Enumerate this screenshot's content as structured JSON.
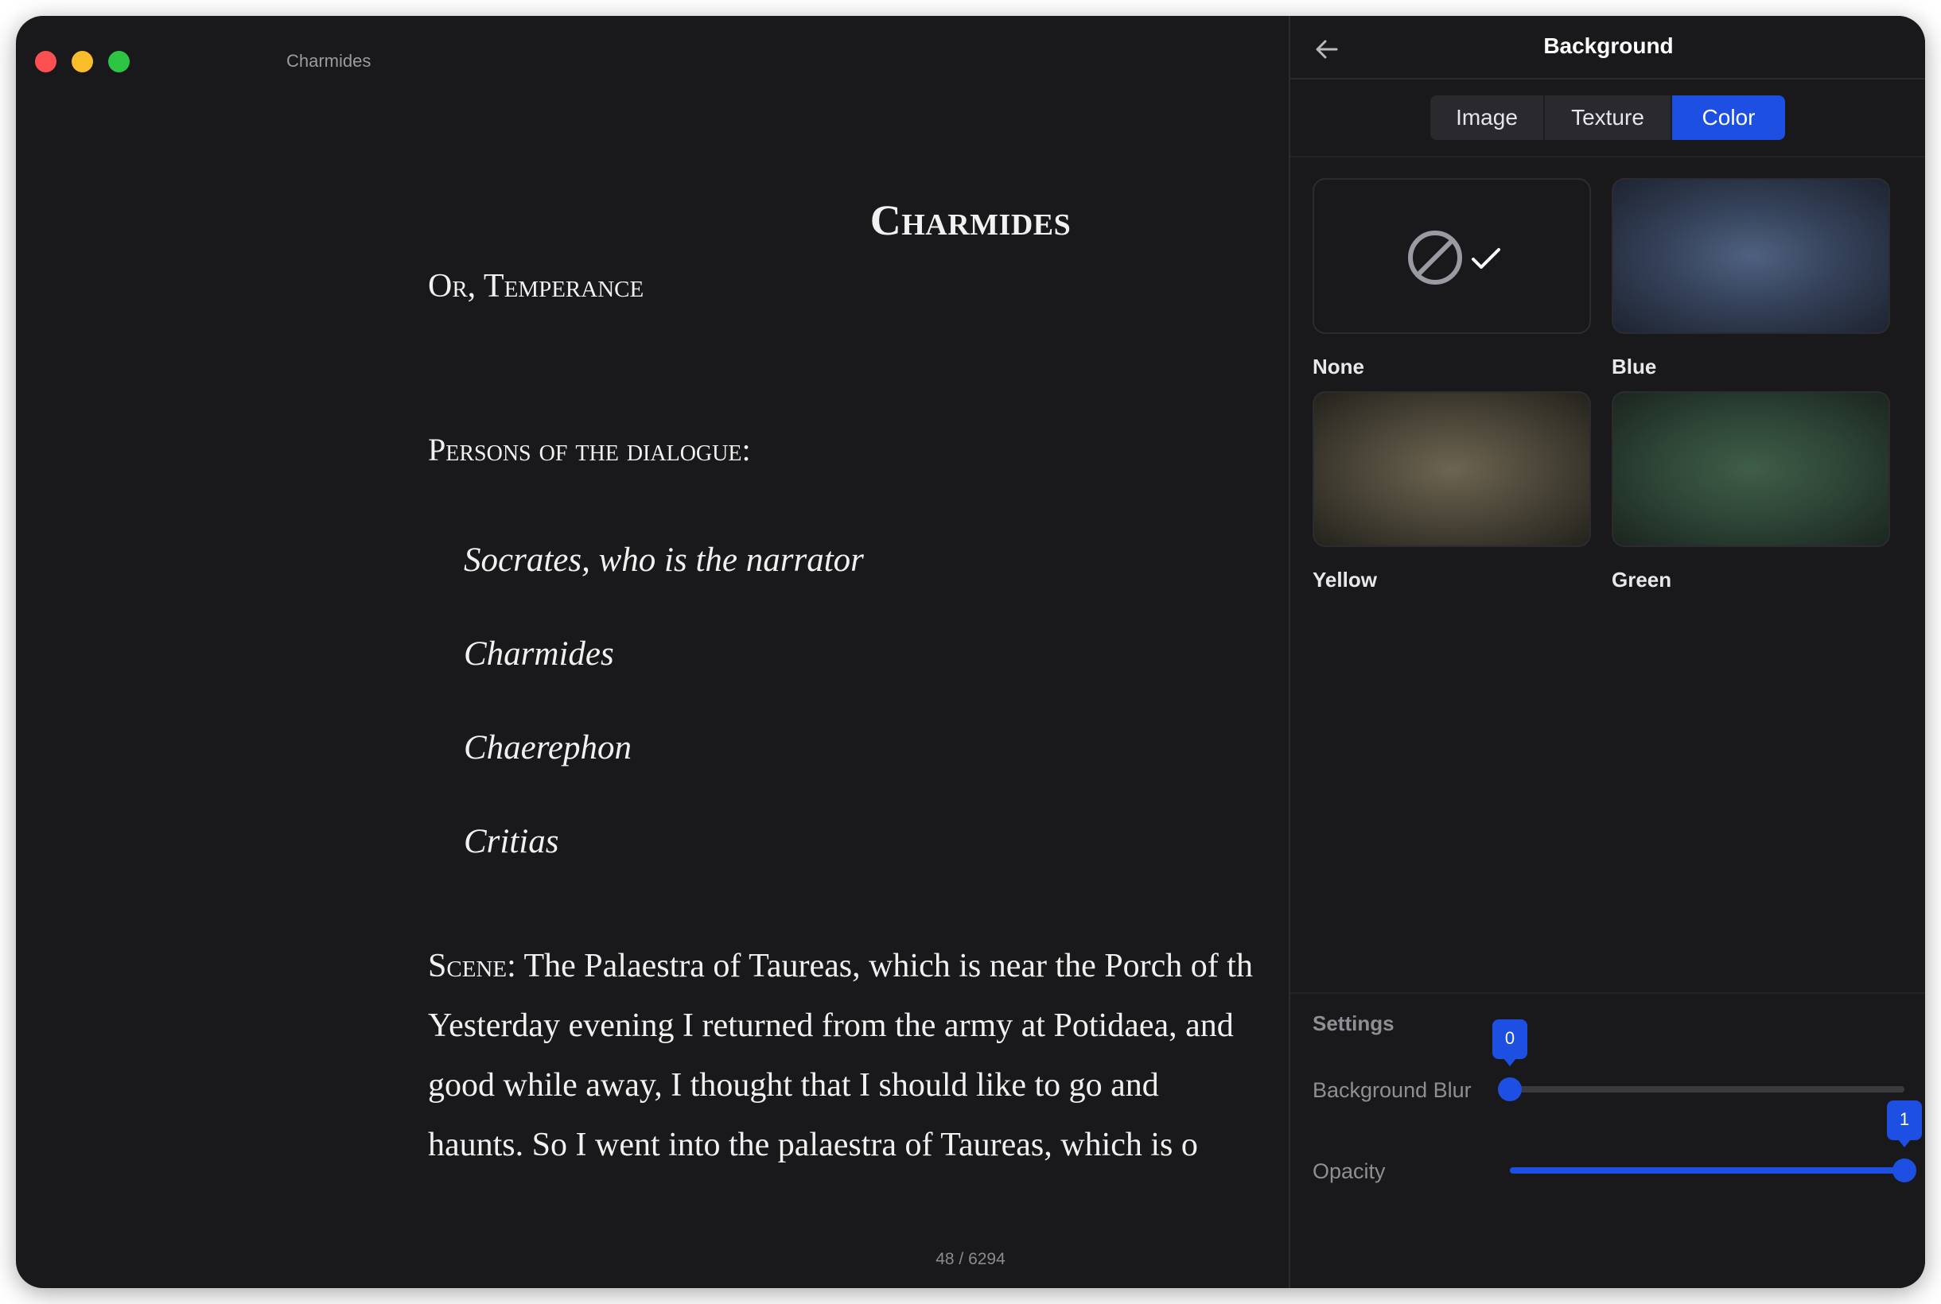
{
  "window": {
    "title": "Charmides"
  },
  "book": {
    "title": "Charmides",
    "subtitle": "Or, Temperance",
    "persons_heading": "Persons of the dialogue:",
    "persons": [
      "Socrates, who is the narrator",
      "Charmides",
      "Chaerephon",
      "Critias"
    ],
    "scene_label": "Scene:",
    "scene_lines": [
      " The Palaestra of Taureas, which is near the Porch of th",
      "Yesterday evening I returned from the army at Potidaea, and",
      "good while away, I thought that I should like to go and",
      "haunts. So I went into the palaestra of Taureas, which is o"
    ]
  },
  "page_indicator": "48 / 6294",
  "panel": {
    "title": "Background",
    "tabs": [
      {
        "label": "Image",
        "active": false
      },
      {
        "label": "Texture",
        "active": false
      },
      {
        "label": "Color",
        "active": true
      }
    ],
    "swatches": [
      {
        "label": "None",
        "selected": true
      },
      {
        "label": "Blue",
        "selected": false
      },
      {
        "label": "Yellow",
        "selected": false
      },
      {
        "label": "Green",
        "selected": false
      }
    ],
    "settings": {
      "heading": "Settings",
      "blur": {
        "label": "Background Blur",
        "value": "0",
        "fraction": 0
      },
      "opacity": {
        "label": "Opacity",
        "value": "1",
        "fraction": 1
      }
    }
  },
  "colors": {
    "accent": "#1e4fe3",
    "background": "#19191b",
    "traffic_red": "#fe4f52",
    "traffic_yellow": "#f7be2a",
    "traffic_green": "#2cc644"
  },
  "icons": {
    "back": "arrow-left-icon",
    "none": "prohibited-icon",
    "selected": "checkmark-icon"
  }
}
